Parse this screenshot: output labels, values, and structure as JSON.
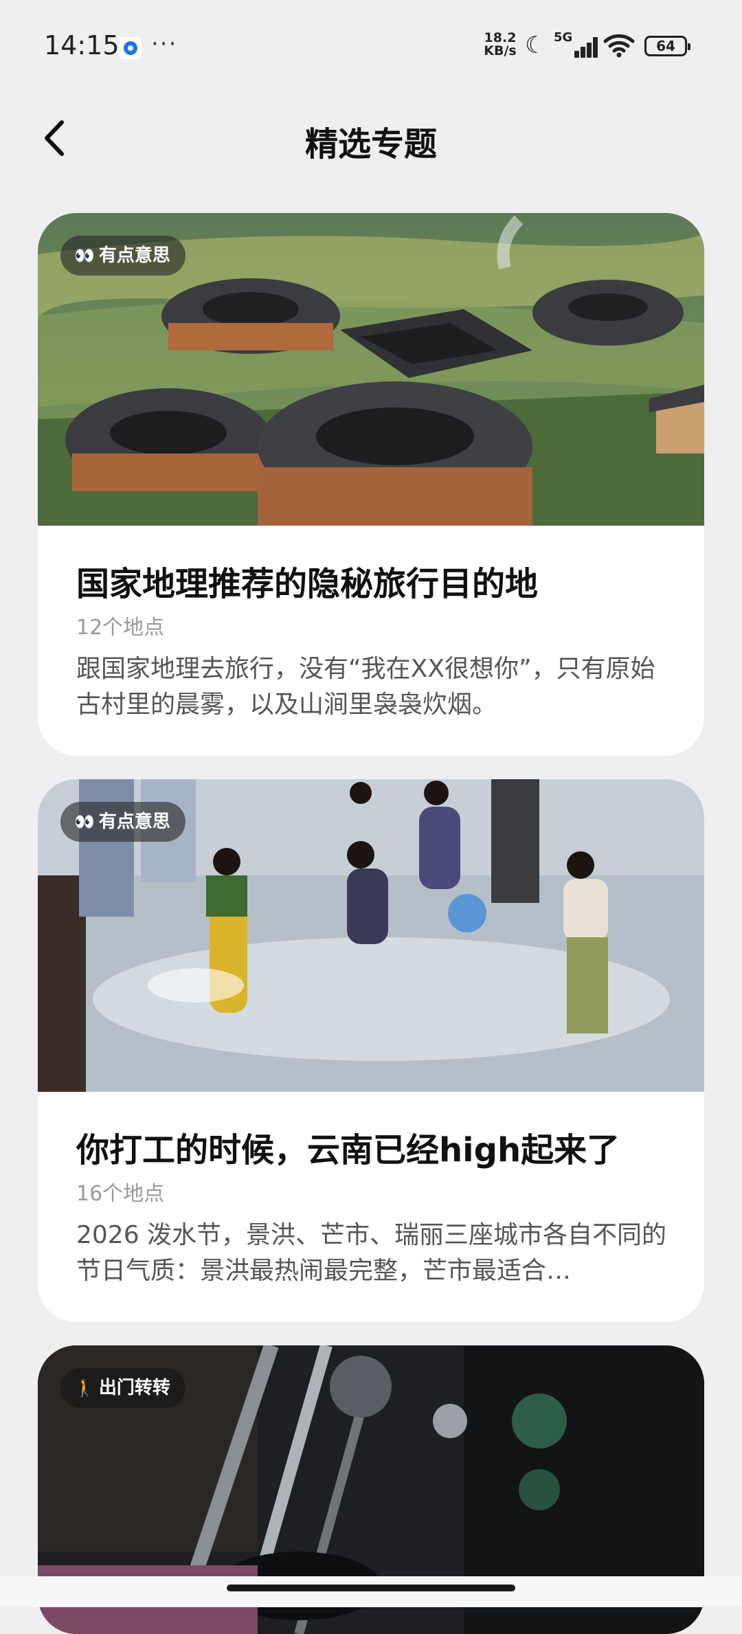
{
  "status_bar": {
    "time": "14:15",
    "more": "···",
    "net_speed_value": "18.2",
    "net_speed_unit": "KB/s",
    "network": "5G",
    "battery": "64"
  },
  "header": {
    "title": "精选专题",
    "back_icon": "chevron-left-icon"
  },
  "cards": [
    {
      "badge": "有点意思",
      "badge_icon": "eyes-icon",
      "title": "国家地理推荐的隐秘旅行目的地",
      "count": "12个地点",
      "description": "跟国家地理去旅行，没有“我在XX很想你”，只有原始古村里的晨雾，以及山涧里袅袅炊烟。"
    },
    {
      "badge": "有点意思",
      "badge_icon": "eyes-icon",
      "title": "你打工的时候，云南已经high起来了",
      "count": "16个地点",
      "description": "2026 泼水节，景洪、芒市、瑞丽三座城市各自不同的节日气质：景洪最热闹最完整，芒市最适合…"
    },
    {
      "badge": "出门转转",
      "badge_icon": "walking-person-icon"
    }
  ],
  "colors": {
    "background": "#efeff2",
    "card": "#ffffff",
    "badge_bg": "#3a3a3a"
  }
}
